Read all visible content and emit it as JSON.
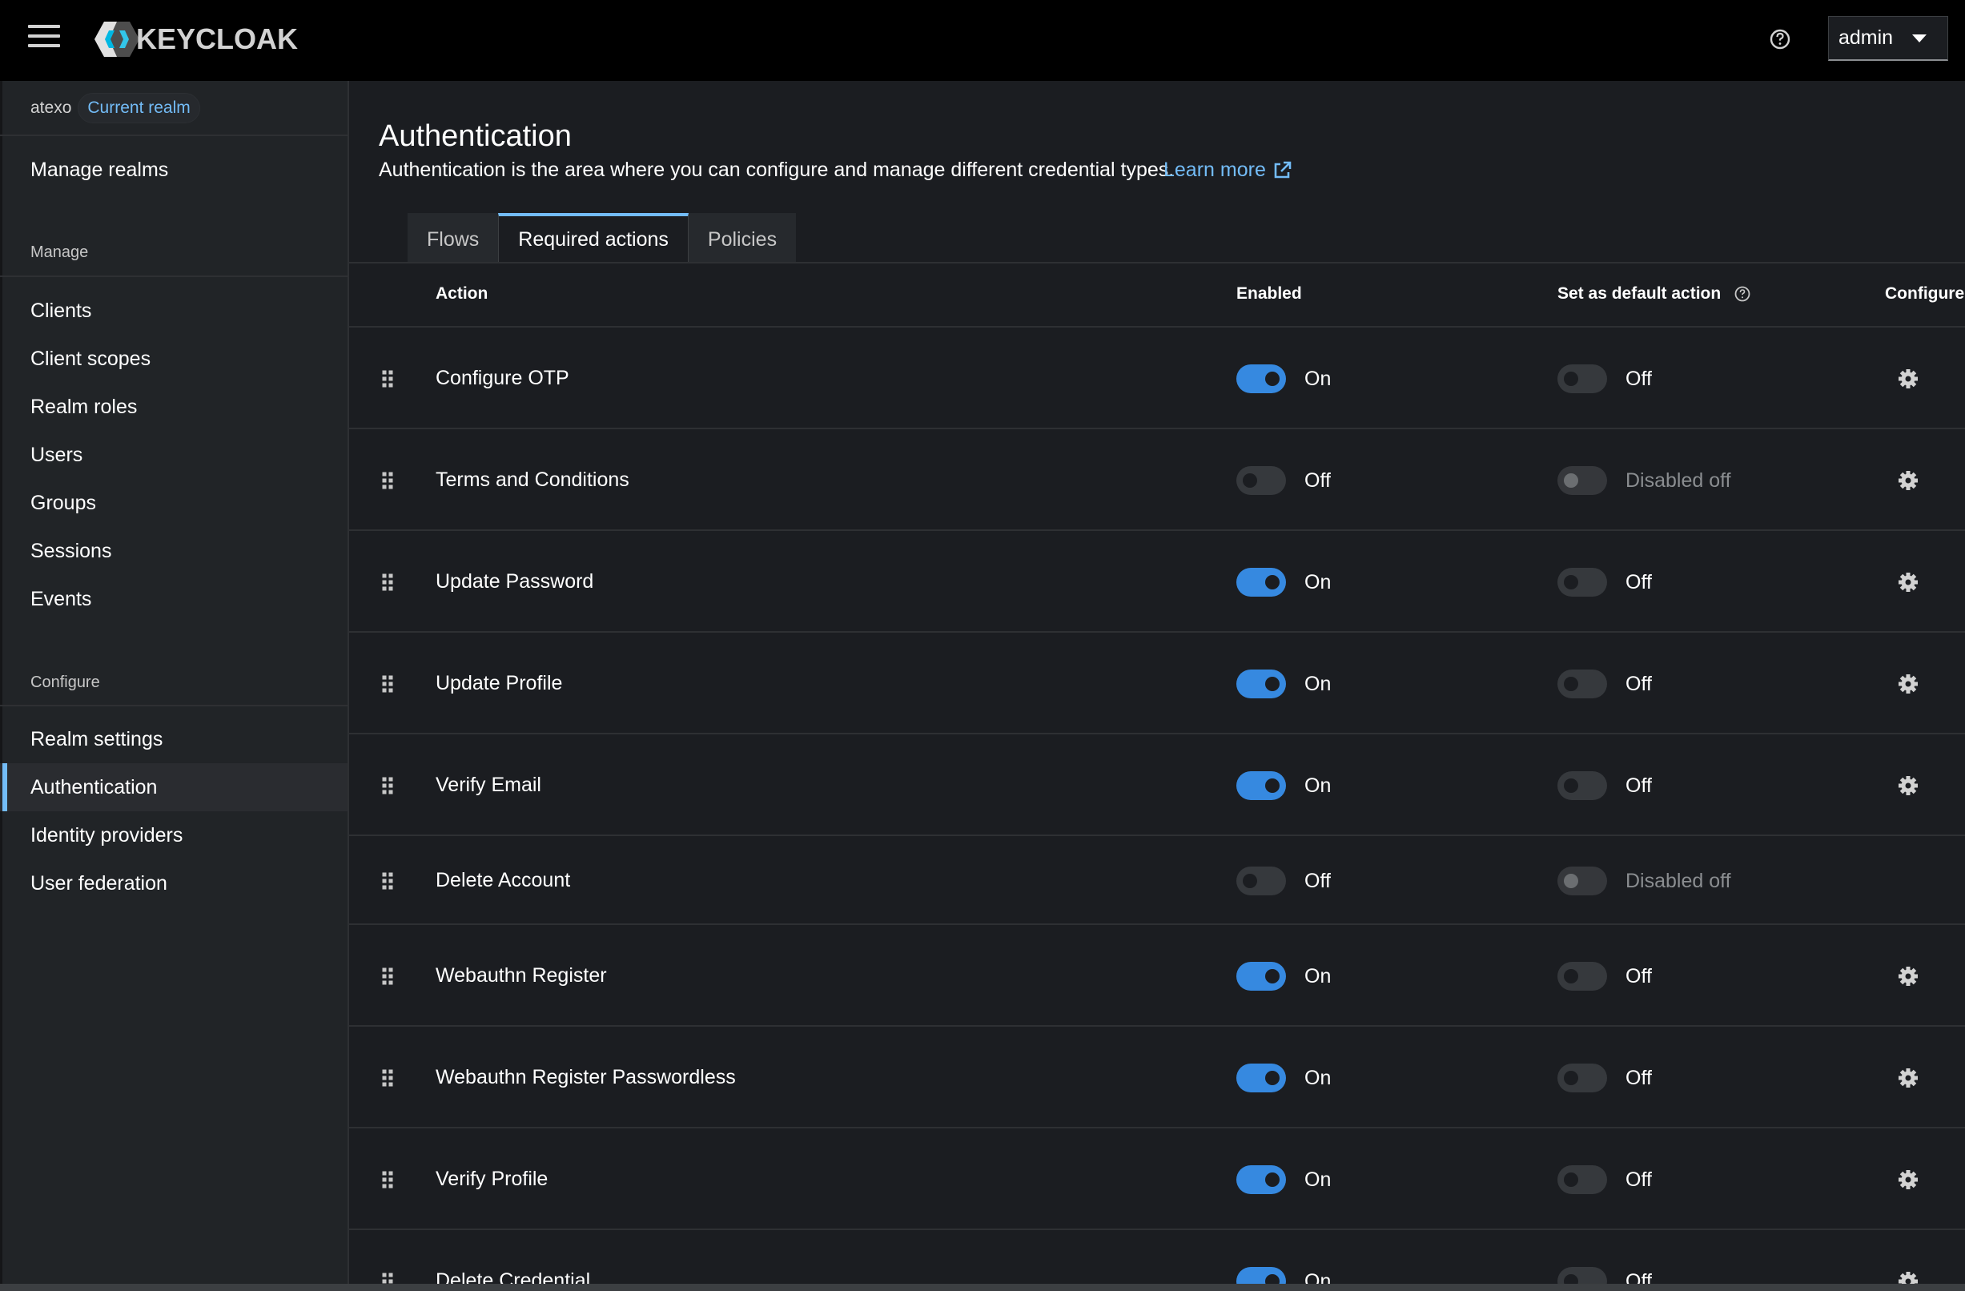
{
  "header": {
    "brand": "KEYCLOAK",
    "user": "admin"
  },
  "sidebar": {
    "realm": "atexo",
    "realm_badge": "Current realm",
    "manage_realms": "Manage realms",
    "manage_section": "Manage",
    "manage_items": [
      "Clients",
      "Client scopes",
      "Realm roles",
      "Users",
      "Groups",
      "Sessions",
      "Events"
    ],
    "configure_section": "Configure",
    "configure_items": [
      "Realm settings",
      "Authentication",
      "Identity providers",
      "User federation"
    ],
    "active_item": "Authentication"
  },
  "page": {
    "title": "Authentication",
    "description": "Authentication is the area where you can configure and manage different credential types.",
    "learn_more": "Learn more",
    "tabs": [
      "Flows",
      "Required actions",
      "Policies"
    ],
    "active_tab": "Required actions"
  },
  "table": {
    "columns": {
      "action": "Action",
      "enabled": "Enabled",
      "default": "Set as default action",
      "configure": "Configure"
    },
    "rows": [
      {
        "name": "Configure OTP",
        "enabled": true,
        "enabled_label": "On",
        "default_state": "off",
        "default_label": "Off",
        "configurable": true
      },
      {
        "name": "Terms and Conditions",
        "enabled": false,
        "enabled_label": "Off",
        "default_state": "disabled",
        "default_label": "Disabled off",
        "configurable": true
      },
      {
        "name": "Update Password",
        "enabled": true,
        "enabled_label": "On",
        "default_state": "off",
        "default_label": "Off",
        "configurable": true
      },
      {
        "name": "Update Profile",
        "enabled": true,
        "enabled_label": "On",
        "default_state": "off",
        "default_label": "Off",
        "configurable": true
      },
      {
        "name": "Verify Email",
        "enabled": true,
        "enabled_label": "On",
        "default_state": "off",
        "default_label": "Off",
        "configurable": true
      },
      {
        "name": "Delete Account",
        "enabled": false,
        "enabled_label": "Off",
        "default_state": "disabled",
        "default_label": "Disabled off",
        "configurable": false
      },
      {
        "name": "Webauthn Register",
        "enabled": true,
        "enabled_label": "On",
        "default_state": "off",
        "default_label": "Off",
        "configurable": true
      },
      {
        "name": "Webauthn Register Passwordless",
        "enabled": true,
        "enabled_label": "On",
        "default_state": "off",
        "default_label": "Off",
        "configurable": true
      },
      {
        "name": "Verify Profile",
        "enabled": true,
        "enabled_label": "On",
        "default_state": "off",
        "default_label": "Off",
        "configurable": true
      },
      {
        "name": "Delete Credential",
        "enabled": true,
        "enabled_label": "On",
        "default_state": "off",
        "default_label": "Off",
        "configurable": true
      }
    ]
  },
  "colors": {
    "accent": "#73bcf7",
    "toggle_on": "#3689e0",
    "background": "#1b1d21",
    "sidebar": "#212427",
    "masthead": "#000000"
  }
}
